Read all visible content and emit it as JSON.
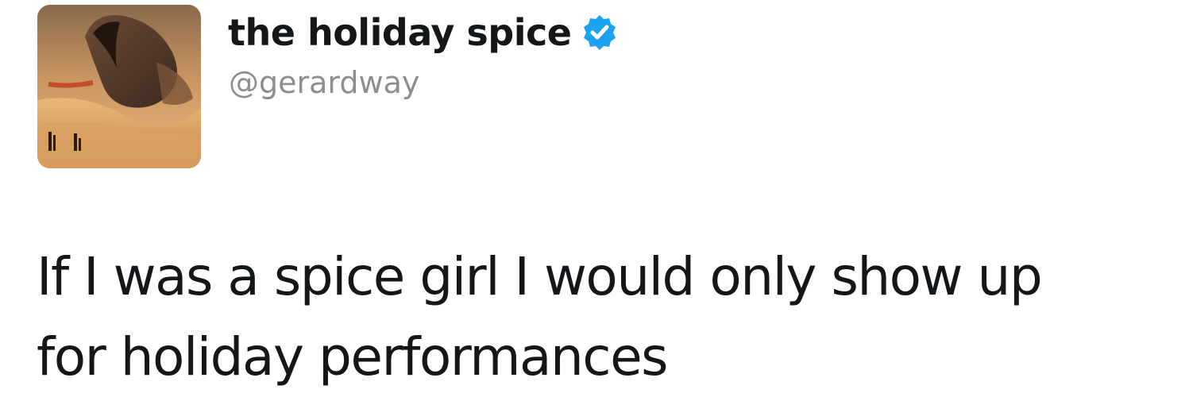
{
  "tweet": {
    "display_name": "the holiday spice",
    "verified_icon": "verified-badge-icon",
    "handle": "@gerardway",
    "text_line_1": "If I was a spice girl I would only show up",
    "text_line_2": "for holiday performances",
    "avatar_icon": "profile-avatar-desert-sandworm-painting"
  },
  "colors": {
    "verified_blue": "#1da1f2",
    "handle_gray": "#8e8e8e",
    "text": "#14171a"
  }
}
